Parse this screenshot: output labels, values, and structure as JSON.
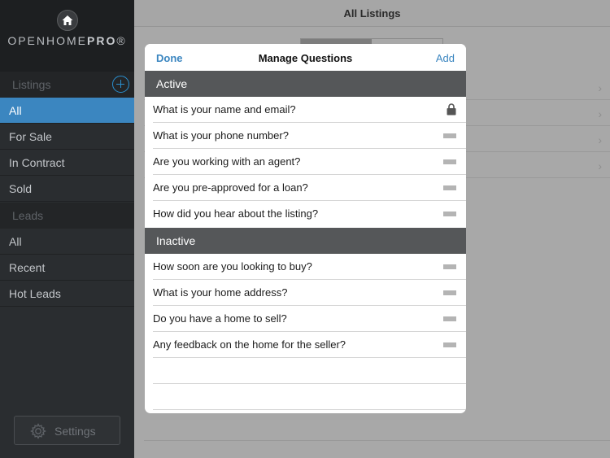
{
  "sidebar": {
    "logo_text_light": "OPENHOME",
    "logo_text_bold": "PRO",
    "logo_mark": "®",
    "listings_header": "Listings",
    "listings_items": [
      {
        "label": "All",
        "active": true
      },
      {
        "label": "For Sale",
        "active": false
      },
      {
        "label": "In Contract",
        "active": false
      },
      {
        "label": "Sold",
        "active": false
      }
    ],
    "leads_header": "Leads",
    "leads_items": [
      {
        "label": "All"
      },
      {
        "label": "Recent"
      },
      {
        "label": "Hot Leads"
      }
    ],
    "settings_label": "Settings"
  },
  "main": {
    "title": "All Listings"
  },
  "modal": {
    "title": "Manage Questions",
    "done_label": "Done",
    "add_label": "Add",
    "active_header": "Active",
    "active_questions": [
      {
        "text": "What is your name and email?",
        "icon": "lock-icon"
      },
      {
        "text": "What is your phone number?",
        "icon": "drag-handle-icon"
      },
      {
        "text": "Are you working with an agent?",
        "icon": "drag-handle-icon"
      },
      {
        "text": "Are you pre-approved for a loan?",
        "icon": "drag-handle-icon"
      },
      {
        "text": "How did you hear about the listing?",
        "icon": "drag-handle-icon"
      }
    ],
    "inactive_header": "Inactive",
    "inactive_questions": [
      {
        "text": "How soon are you looking to buy?",
        "icon": "drag-handle-icon"
      },
      {
        "text": "What is your home address?",
        "icon": "drag-handle-icon"
      },
      {
        "text": "Do you have a home to sell?",
        "icon": "drag-handle-icon"
      },
      {
        "text": "Any feedback on the home for the seller?",
        "icon": "drag-handle-icon"
      }
    ]
  },
  "colors": {
    "accent": "#3b86c0",
    "sidebar_bg": "#2a2d30",
    "group_header_bg": "#555759"
  }
}
